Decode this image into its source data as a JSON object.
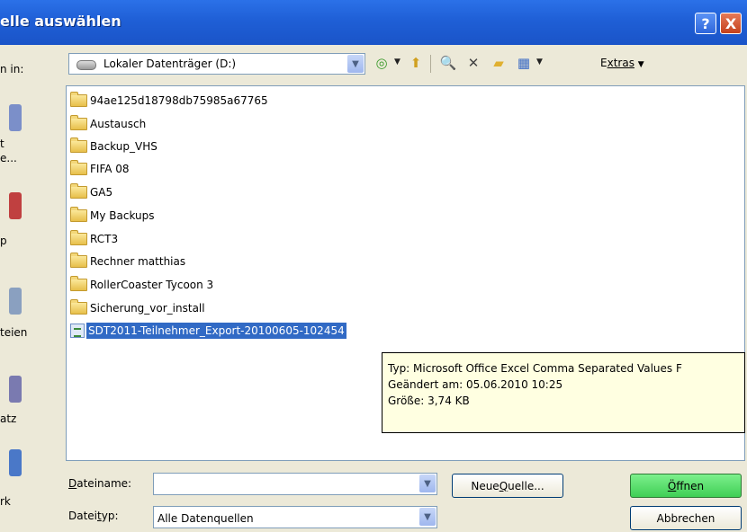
{
  "titlebar": {
    "title": "elle auswählen",
    "help_label": "?",
    "close_label": "X"
  },
  "lookin": {
    "label": "n in:",
    "value": "Lokaler Datenträger (D:)",
    "extras_label": "Extras",
    "extras_prefix": "E",
    "extras_rest": "xtras"
  },
  "places": [
    {
      "label": "t\ne..."
    },
    {
      "label": "p"
    },
    {
      "label": "teien"
    },
    {
      "label": "atz"
    },
    {
      "label": "rk"
    }
  ],
  "files": [
    {
      "name": "94ae125d18798db75985a67765",
      "type": "folder"
    },
    {
      "name": "Austausch",
      "type": "folder"
    },
    {
      "name": "Backup_VHS",
      "type": "folder"
    },
    {
      "name": "FIFA 08",
      "type": "folder"
    },
    {
      "name": "GA5",
      "type": "folder"
    },
    {
      "name": "My Backups",
      "type": "folder"
    },
    {
      "name": "RCT3",
      "type": "folder"
    },
    {
      "name": "Rechner matthias",
      "type": "folder"
    },
    {
      "name": "RollerCoaster Tycoon 3",
      "type": "folder"
    },
    {
      "name": "Sicherung_vor_install",
      "type": "folder"
    },
    {
      "name": "SDT2011-Teilnehmer_Export-20100605-102454",
      "type": "csv",
      "selected": true
    }
  ],
  "tooltip": {
    "type_line": "Typ: Microsoft Office Excel Comma Separated Values F",
    "modified_line": "Geändert am: 05.06.2010 10:25",
    "size_line": "Größe: 3,74 KB"
  },
  "bottom": {
    "filename_label_u": "D",
    "filename_label_rest": "ateiname:",
    "filename_value": "",
    "filetype_label_a": "Datei",
    "filetype_label_u": "t",
    "filetype_label_rest": "yp:",
    "filetype_value": "Alle Datenquellen",
    "new_source_a": "Neue ",
    "new_source_u": "Q",
    "new_source_rest": "uelle...",
    "open_u": "Ö",
    "open_rest": "ffnen",
    "cancel_label": "Abbrechen"
  }
}
